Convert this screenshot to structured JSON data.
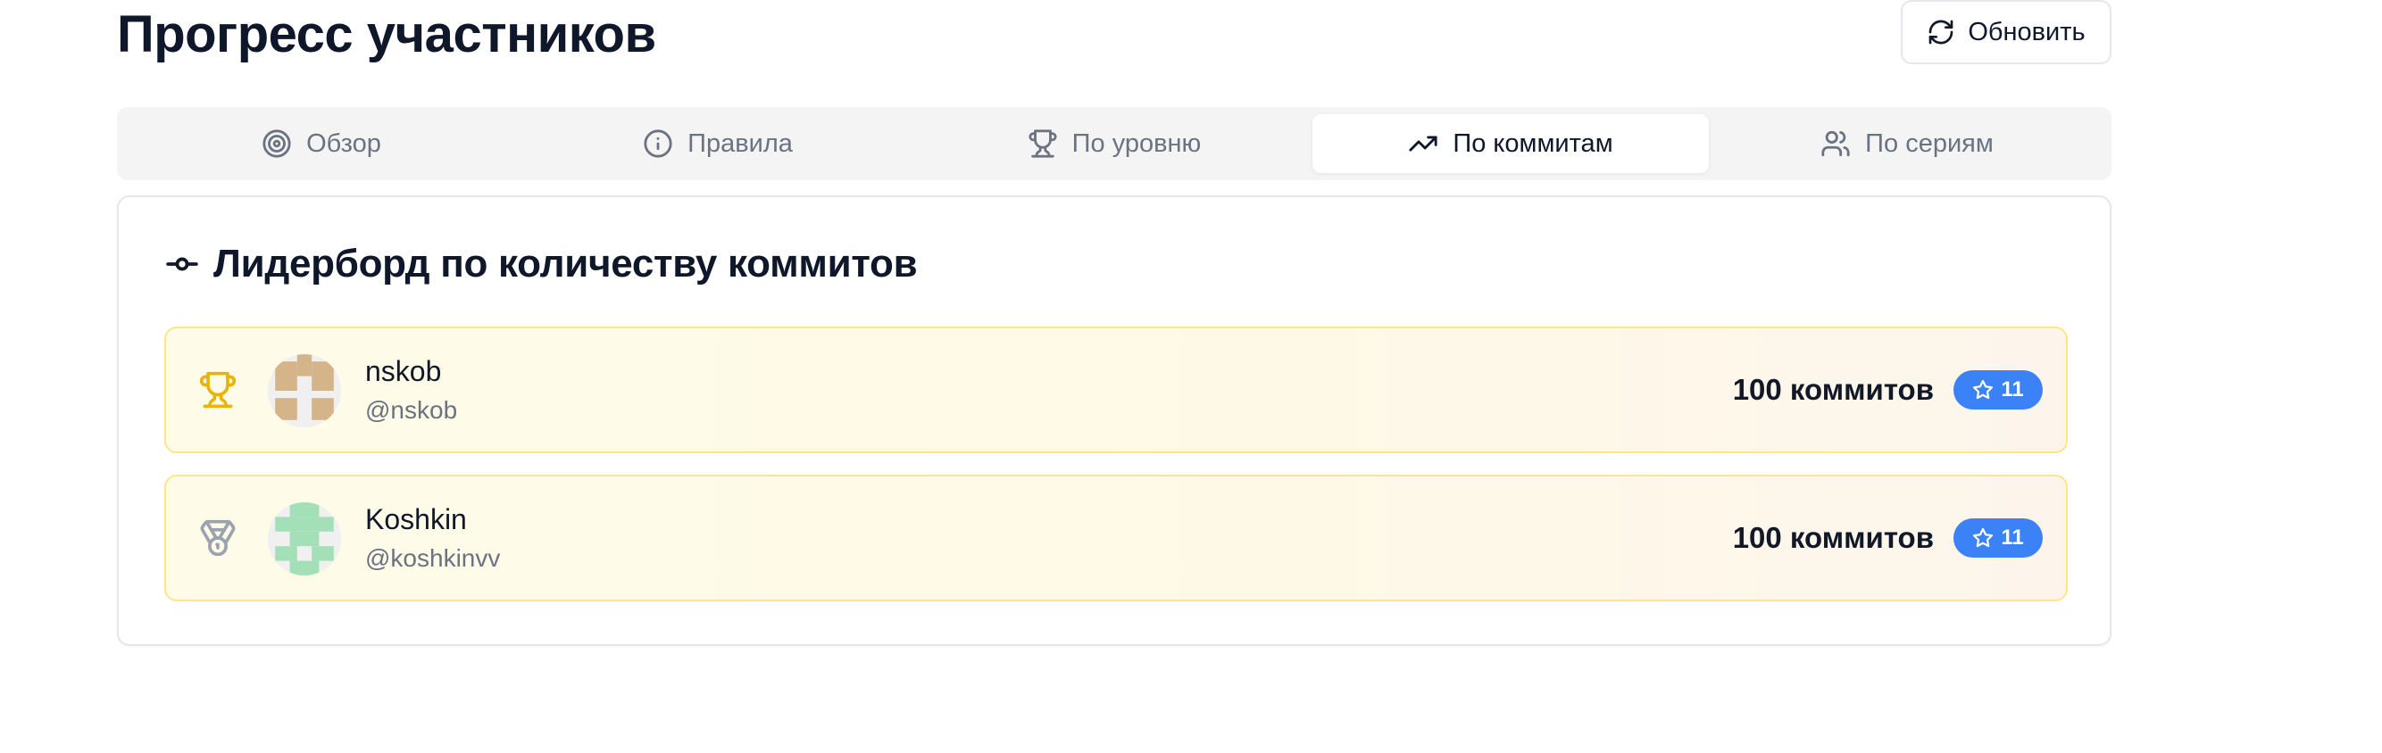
{
  "header": {
    "title": "Прогресс участников",
    "refresh_label": "Обновить"
  },
  "tabs": [
    {
      "label": "Обзор",
      "icon": "target-icon",
      "active": false
    },
    {
      "label": "Правила",
      "icon": "info-icon",
      "active": false
    },
    {
      "label": "По уровню",
      "icon": "trophy-icon",
      "active": false
    },
    {
      "label": "По коммитам",
      "icon": "trending-up-icon",
      "active": true
    },
    {
      "label": "По сериям",
      "icon": "users-icon",
      "active": false
    }
  ],
  "leaderboard": {
    "title": "Лидерборд по количеству коммитов",
    "title_icon": "git-commit-icon",
    "entries": [
      {
        "rank_icon": "trophy-icon",
        "name": "nskob",
        "handle": "@nskob",
        "commits": "100 коммитов",
        "stars": "11",
        "avatar_color": "#d6b48a"
      },
      {
        "rank_icon": "medal-icon",
        "name": "Koshkin",
        "handle": "@koshkinvv",
        "commits": "100 коммитов",
        "stars": "11",
        "avatar_color": "#a3e0b7"
      }
    ]
  },
  "colors": {
    "accent": "#3b82f6",
    "gold": "#eab308",
    "silver": "#9ca3af",
    "entry_border": "#fde68a"
  }
}
